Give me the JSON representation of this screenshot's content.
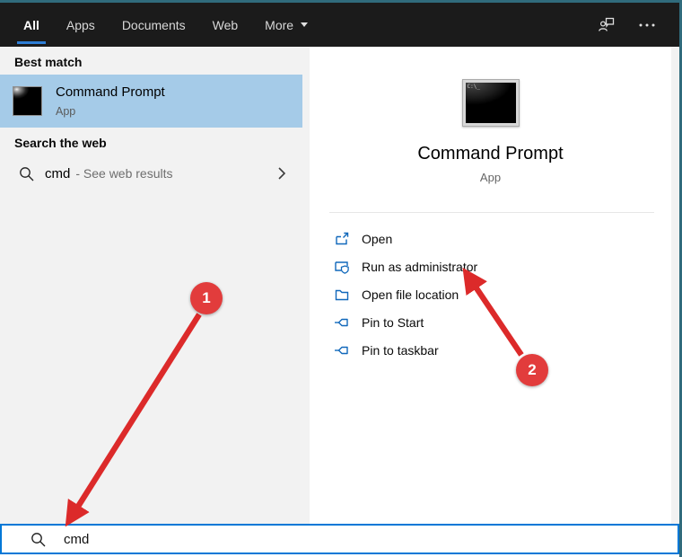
{
  "nav": {
    "tabs": [
      {
        "label": "All",
        "active": true
      },
      {
        "label": "Apps",
        "active": false
      },
      {
        "label": "Documents",
        "active": false
      },
      {
        "label": "Web",
        "active": false
      },
      {
        "label": "More",
        "active": false,
        "has_dropdown": true
      }
    ],
    "icons": [
      "feedback-icon",
      "ellipsis-icon"
    ]
  },
  "left_panel": {
    "best_match": {
      "header": "Best match",
      "result": {
        "name": "Command Prompt",
        "type": "App",
        "icon": "command-prompt-icon"
      }
    },
    "search_web": {
      "header": "Search the web",
      "query": "cmd",
      "suffix": "- See web results",
      "icons": [
        "search-icon",
        "chevron-right-icon"
      ]
    }
  },
  "right_panel": {
    "app_name": "Command Prompt",
    "app_type": "App",
    "app_icon": "command-prompt-icon",
    "app_icon_text": "C:\\_",
    "actions": [
      {
        "label": "Open",
        "icon": "launch-icon"
      },
      {
        "label": "Run as administrator",
        "icon": "admin-shield-icon"
      },
      {
        "label": "Open file location",
        "icon": "folder-icon"
      },
      {
        "label": "Pin to Start",
        "icon": "pin-icon"
      },
      {
        "label": "Pin to taskbar",
        "icon": "pin-icon"
      }
    ]
  },
  "search_bar": {
    "query": "cmd",
    "icon": "search-icon"
  },
  "annotations": {
    "step1": "1",
    "step2": "2"
  },
  "colors": {
    "accent_blue": "#0078d7",
    "tab_underline": "#2e7ed6",
    "highlight_blue": "#a5cbe8",
    "annotation_red": "#e23c3c",
    "window_border_teal": "#306b7c",
    "navbar_bg": "#1b1b1b",
    "panel_gray": "#f2f2f2",
    "action_icon_blue": "#1168bb"
  }
}
